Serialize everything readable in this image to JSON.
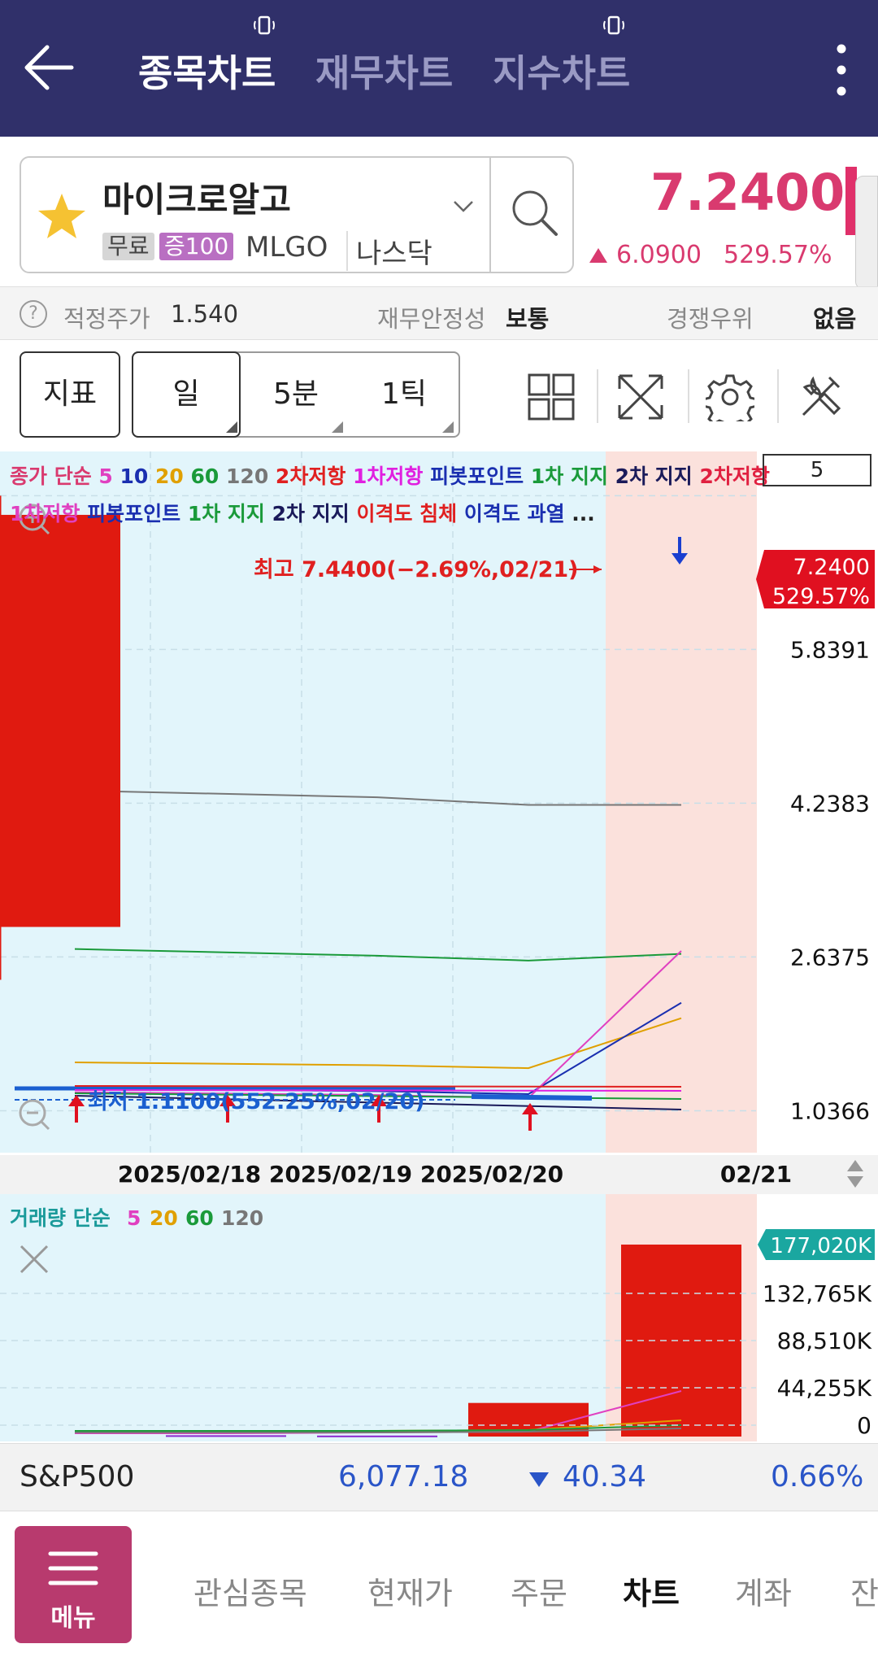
{
  "header": {
    "tabs": [
      "종목차트",
      "재무차트",
      "지수차트"
    ],
    "active_tab": "종목차트"
  },
  "stock": {
    "name": "마이크로알고",
    "badge_free": "무료",
    "badge_margin": "증100",
    "ticker": "MLGO",
    "exchange": "나스닥",
    "price": "7.2400",
    "change": "6.0900",
    "change_pct": "529.57%",
    "up_color": "#d93a6f"
  },
  "info_row": {
    "fair_price_label": "적정주가",
    "fair_price_value": "1.540",
    "stability_label": "재무안정성",
    "stability_value": "보통",
    "competition_label": "경쟁우위",
    "competition_value": "없음"
  },
  "toolbar": {
    "indicator_label": "지표",
    "periods": [
      "일",
      "5분",
      "1틱"
    ],
    "active_period": "일",
    "icons": [
      "layout-grid-icon",
      "fullscreen-icon",
      "settings-icon",
      "tools-icon"
    ]
  },
  "legend": {
    "line1": [
      {
        "text": "종가 단순",
        "color": "#d93a6f"
      },
      {
        "text": "5",
        "color": "#e040c0"
      },
      {
        "text": "10",
        "color": "#1a2fb0"
      },
      {
        "text": "20",
        "color": "#e0a000"
      },
      {
        "text": "60",
        "color": "#1a9a3a"
      },
      {
        "text": "120",
        "color": "#777777"
      },
      {
        "text": "2차저항",
        "color": "#e02020"
      },
      {
        "text": "1차저항",
        "color": "#e020e0"
      },
      {
        "text": "피봇포인트",
        "color": "#1a2fb0"
      },
      {
        "text": "1차 지지",
        "color": "#1a9a3a"
      },
      {
        "text": "2차 지지",
        "color": "#1a1a5a"
      },
      {
        "text": "2차저항",
        "color": "#e02040"
      }
    ],
    "line2": [
      {
        "text": "1차저항",
        "color": "#e040c0"
      },
      {
        "text": "피봇포인트",
        "color": "#1a2fb0"
      },
      {
        "text": "1차 지지",
        "color": "#1a9a3a"
      },
      {
        "text": "2차 지지",
        "color": "#1a1a5a"
      },
      {
        "text": "이격도 침체",
        "color": "#e02020"
      },
      {
        "text": "이격도 과열",
        "color": "#1a2fb0"
      },
      {
        "text": "...",
        "color": "#222222"
      }
    ],
    "period_value": "5"
  },
  "chart_data": [
    {
      "type": "candlestick",
      "categories": [
        "2025/02/18",
        "2025/02/19",
        "2025/02/20",
        "02/21"
      ],
      "candles": [
        {
          "date": "2025/02/21",
          "open": 2.95,
          "high": 7.44,
          "low": 2.4,
          "close": 7.24
        }
      ],
      "y_ticks": [
        "5.8391",
        "4.2383",
        "2.6375",
        "1.0366"
      ],
      "ylim": [
        0.6,
        7.9
      ],
      "price_label": "7.2400",
      "price_pct_label": "529.57%",
      "high_annotation": "최고 7.4400(−2.69%,02/21)",
      "low_annotation": "최저 1.1100(552.25%,02/20)",
      "ma_lines": [
        {
          "name": "120",
          "color": "#777777",
          "values": [
            4.37,
            4.3,
            4.22,
            4.22
          ]
        },
        {
          "name": "60",
          "color": "#1a9a3a",
          "values": [
            2.72,
            2.65,
            2.6,
            2.67
          ]
        },
        {
          "name": "20",
          "color": "#e0a000",
          "values": [
            1.54,
            1.51,
            1.48,
            2.0
          ]
        },
        {
          "name": "10",
          "color": "#1a2fb0",
          "values": [
            1.27,
            1.24,
            1.21,
            2.16
          ]
        },
        {
          "name": "5",
          "color": "#e040c0",
          "values": [
            1.23,
            1.2,
            1.17,
            2.7
          ]
        }
      ],
      "grid": true
    },
    {
      "type": "bar",
      "title": "거래량 단순",
      "legend": [
        {
          "text": "거래량 단순",
          "color": "#1a9a9a"
        },
        {
          "text": "5",
          "color": "#e040c0"
        },
        {
          "text": "20",
          "color": "#e0a000"
        },
        {
          "text": "60",
          "color": "#1a9a3a"
        },
        {
          "text": "120",
          "color": "#777777"
        }
      ],
      "categories": [
        "2025/02/18",
        "2025/02/19",
        "2025/02/20",
        "02/21"
      ],
      "values": [
        1200,
        900,
        31000,
        177020
      ],
      "y_ticks": [
        "132,765K",
        "88,510K",
        "44,255K",
        "0"
      ],
      "last_label": "177,020K",
      "ylim": [
        0,
        190000
      ]
    }
  ],
  "index_bar": {
    "name": "S&P500",
    "value": "6,077.18",
    "change": "40.34",
    "change_pct": "0.66%"
  },
  "bottom_nav": {
    "menu_label": "메뉴",
    "items": [
      "관심종목",
      "현재가",
      "주문",
      "차트",
      "계좌"
    ],
    "active": "차트"
  }
}
